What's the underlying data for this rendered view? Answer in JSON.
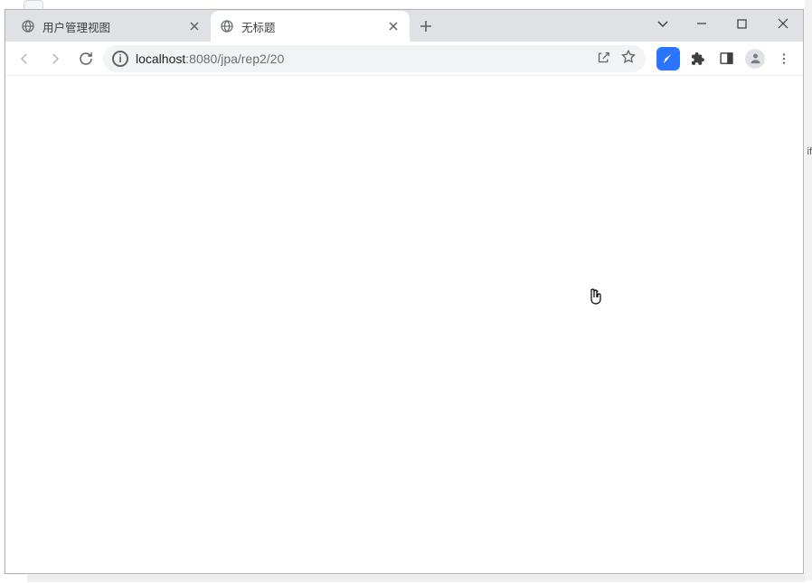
{
  "tabs": [
    {
      "title": "用户管理视图"
    },
    {
      "title": "无标题"
    }
  ],
  "url": {
    "host": "localhost",
    "port": ":8080",
    "path": "/jpa/rep2/20"
  },
  "outside": {
    "rightChar": "if"
  }
}
